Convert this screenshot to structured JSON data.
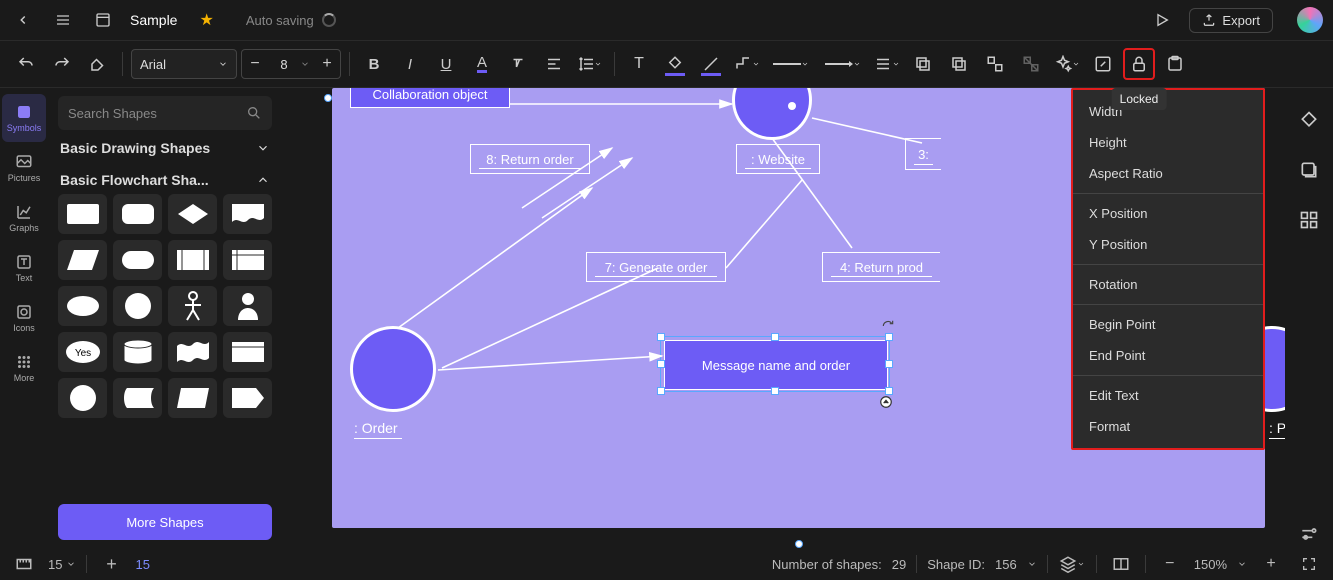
{
  "app": {
    "title": "Sample",
    "autosave": "Auto saving"
  },
  "top": {
    "export": "Export"
  },
  "toolbar": {
    "font": "Arial",
    "fontsize": "8",
    "lock_tooltip": "Locked"
  },
  "rail": {
    "items": [
      {
        "label": "Symbols"
      },
      {
        "label": "Pictures"
      },
      {
        "label": "Graphs"
      },
      {
        "label": "Text"
      },
      {
        "label": "Icons"
      },
      {
        "label": "More"
      }
    ]
  },
  "shapes": {
    "search_placeholder": "Search Shapes",
    "section_basic": "Basic Drawing Shapes",
    "section_flow": "Basic Flowchart Sha...",
    "yes_label": "Yes",
    "more_btn": "More Shapes"
  },
  "canvas": {
    "collab": "Collaboration object",
    "return_order": "8: Return order",
    "website": ": Website",
    "three_prefix": "3:",
    "generate": "7: Generate order",
    "return_prod": "4: Return prod",
    "message": "Message name and order",
    "order": ": Order",
    "product": ": Product"
  },
  "context_menu": {
    "items": [
      "Width",
      "Height",
      "Aspect Ratio",
      "X Position",
      "Y Position",
      "Rotation",
      "Begin Point",
      "End Point",
      "Edit Text",
      "Format"
    ]
  },
  "status": {
    "left_val": "15",
    "left_blue": "15",
    "shapes_count_lbl": "Number of shapes:",
    "shapes_count_val": "29",
    "shape_id_lbl": "Shape ID:",
    "shape_id_val": "156",
    "zoom": "150%"
  }
}
